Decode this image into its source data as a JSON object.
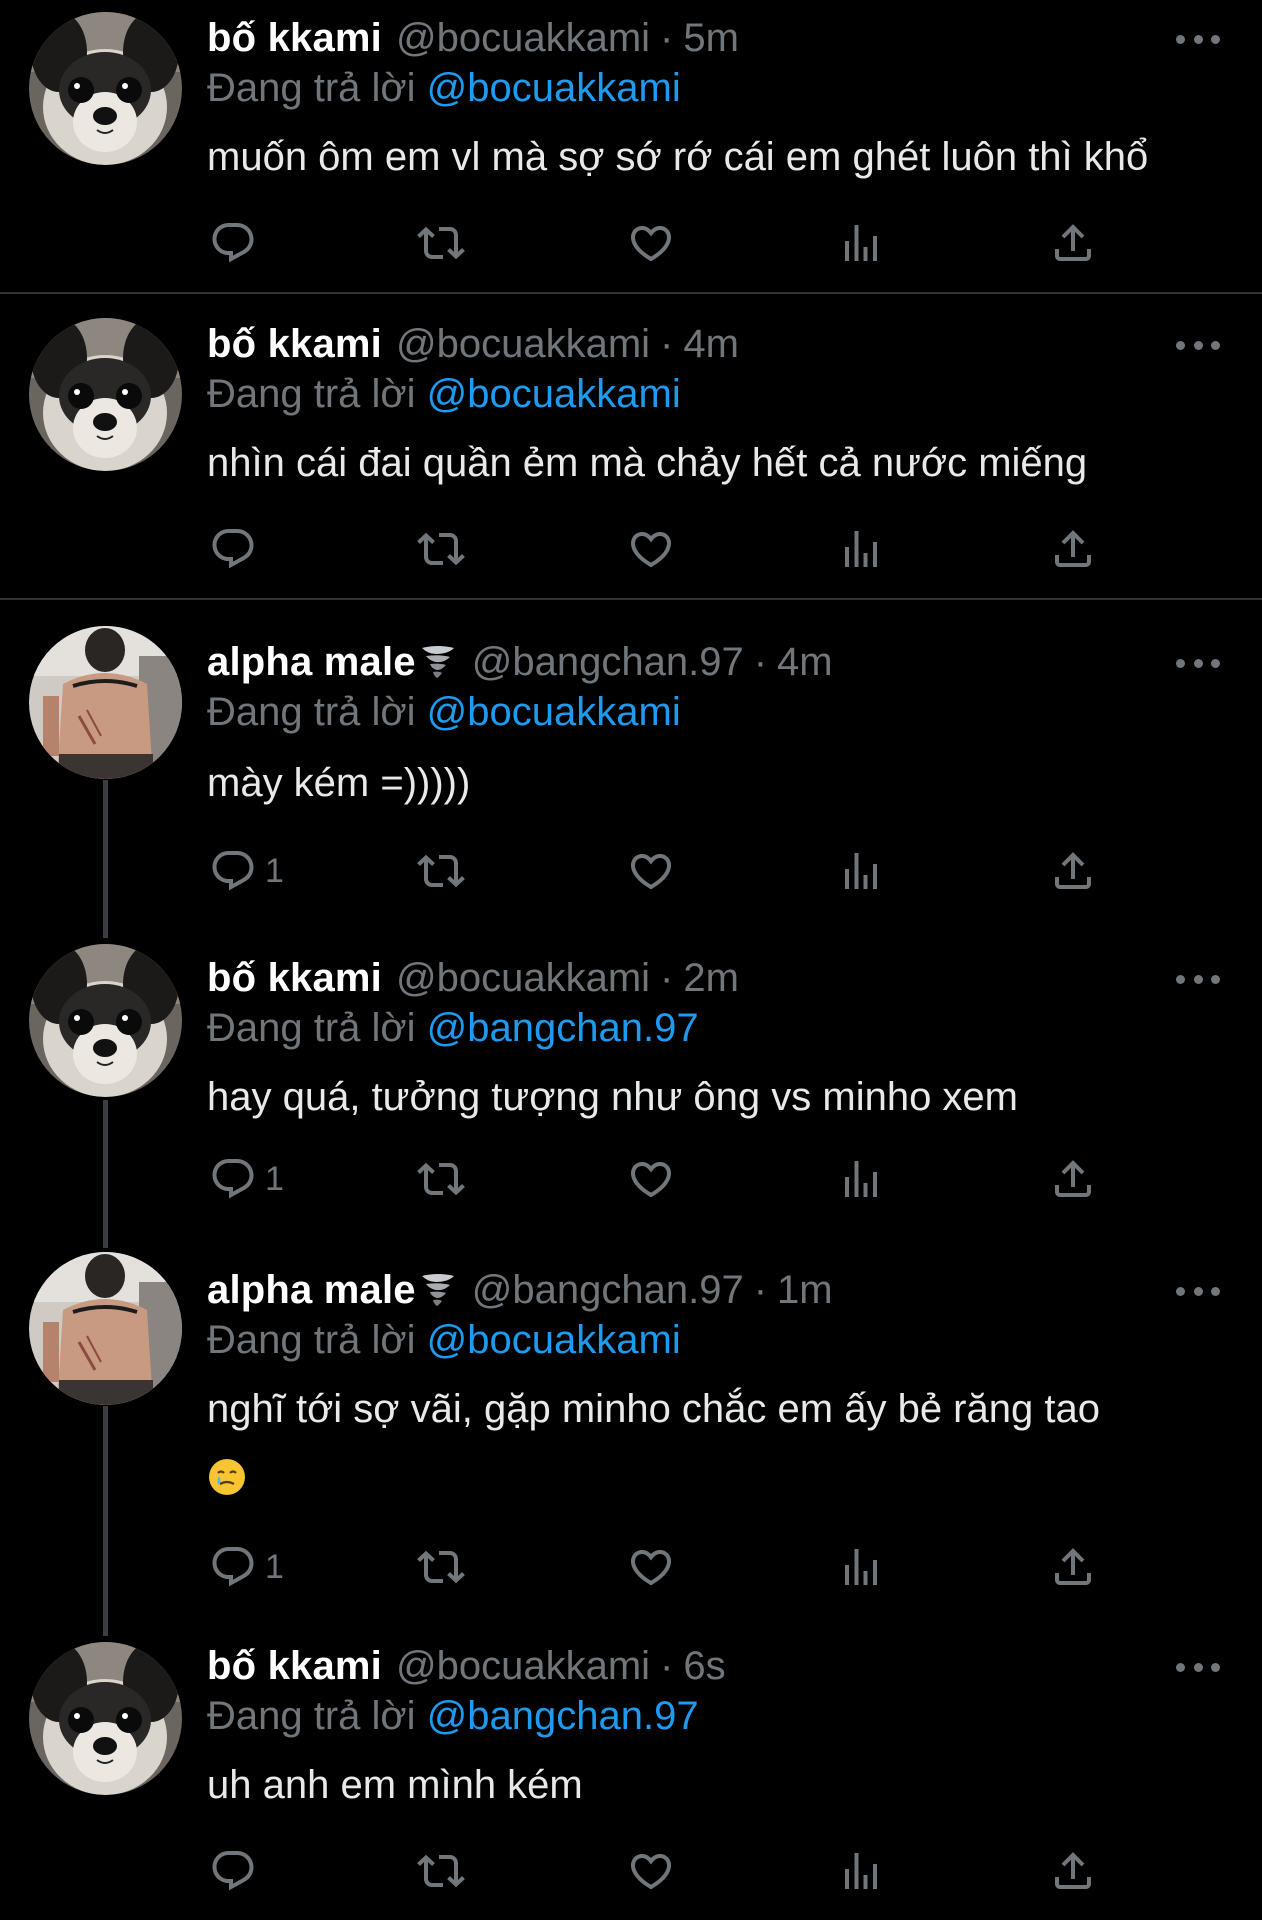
{
  "replying_label": "Đang trả lời",
  "tweets": [
    {
      "name": "bố kkami",
      "handle": "@bocuakkami",
      "time": "5m",
      "reply_to": "@bocuakkami",
      "text": "muốn ôm em vl mà sợ sớ rớ cái em ghét luôn thì khổ",
      "reply_count": "",
      "avatar": "dog-avatar"
    },
    {
      "name": "bố kkami",
      "handle": "@bocuakkami",
      "time": "4m",
      "reply_to": "@bocuakkami",
      "text": "nhìn cái đai quần ẻm mà chảy hết cả nước miếng",
      "reply_count": "",
      "avatar": "dog-avatar"
    },
    {
      "name": "alpha male",
      "handle": "@bangchan.97",
      "time": "4m",
      "reply_to": "@bocuakkami",
      "text": "mày kém =)))))",
      "reply_count": "1",
      "avatar": "person-back-avatar"
    },
    {
      "name": "bố kkami",
      "handle": "@bocuakkami",
      "time": "2m",
      "reply_to": "@bangchan.97",
      "text": "hay quá, tưởng tượng như ông vs minho xem",
      "reply_count": "1",
      "avatar": "dog-avatar"
    },
    {
      "name": "alpha male",
      "handle": "@bangchan.97",
      "time": "1m",
      "reply_to": "@bocuakkami",
      "text": "nghĩ tới sợ vãi, gặp minho chắc em ấy bẻ răng tao",
      "reply_count": "1",
      "avatar": "person-back-avatar"
    },
    {
      "name": "bố kkami",
      "handle": "@bocuakkami",
      "time": "6s",
      "reply_to": "@bangchan.97",
      "text": "uh anh em mình kém",
      "reply_count": "",
      "avatar": "dog-avatar"
    }
  ],
  "icons": {
    "name_badge": "tornado-emoji",
    "text_emoji": "smiling-face-with-tear-emoji",
    "actions": [
      "reply-icon",
      "retweet-icon",
      "like-icon",
      "views-icon",
      "share-icon"
    ]
  },
  "colors": {
    "background": "#000000",
    "text": "#e7e9ea",
    "muted": "#71767b",
    "mention": "#1d9bf0",
    "divider": "#2f3336"
  }
}
